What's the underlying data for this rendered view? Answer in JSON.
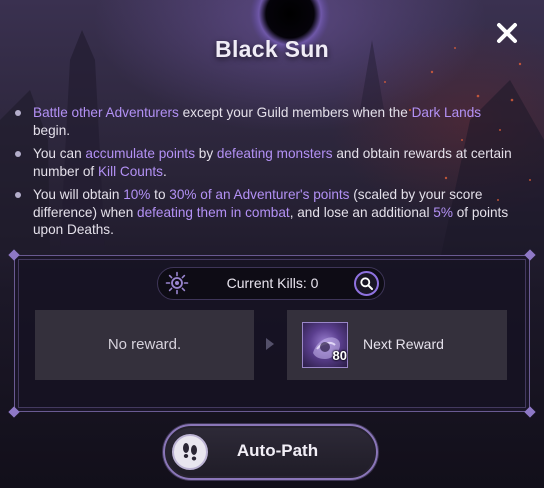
{
  "dialog": {
    "title": "Black Sun",
    "close_icon": "close-icon"
  },
  "rules": [
    {
      "parts": [
        {
          "text": "Battle other Adventurers",
          "hl": true
        },
        {
          "text": " except your Guild members when the ",
          "hl": false
        },
        {
          "text": "Dark Lands",
          "hl": true
        },
        {
          "text": " begin.",
          "hl": false
        }
      ]
    },
    {
      "parts": [
        {
          "text": "You can ",
          "hl": false
        },
        {
          "text": "accumulate points",
          "hl": true
        },
        {
          "text": " by ",
          "hl": false
        },
        {
          "text": "defeating monsters",
          "hl": true
        },
        {
          "text": " and obtain rewards at certain number of ",
          "hl": false
        },
        {
          "text": "Kill Counts",
          "hl": true
        },
        {
          "text": ".",
          "hl": false
        }
      ]
    },
    {
      "parts": [
        {
          "text": "You will obtain ",
          "hl": false
        },
        {
          "text": "10%",
          "hl": true
        },
        {
          "text": " to ",
          "hl": false
        },
        {
          "text": "30% of an Adventurer's points",
          "hl": true
        },
        {
          "text": " (scaled by your score difference) when ",
          "hl": false
        },
        {
          "text": "defeating them in combat",
          "hl": true
        },
        {
          "text": ", and lose an additional ",
          "hl": false
        },
        {
          "text": "5%",
          "hl": true
        },
        {
          "text": " of points upon Deaths.",
          "hl": false
        }
      ]
    }
  ],
  "kills": {
    "label": "Current Kills: 0",
    "icon": "sun-emblem-icon",
    "search_icon": "search-icon"
  },
  "rewards": {
    "current": "No reward.",
    "arrow_icon": "chevron-right-icon",
    "next_label": "Next Reward",
    "next_item_count": "80",
    "next_item_icon": "reward-item-icon"
  },
  "auto_path": {
    "label": "Auto-Path",
    "icon": "footprints-icon"
  },
  "colors": {
    "highlight": "#b391f5",
    "accent_border": "#8a76b8"
  }
}
